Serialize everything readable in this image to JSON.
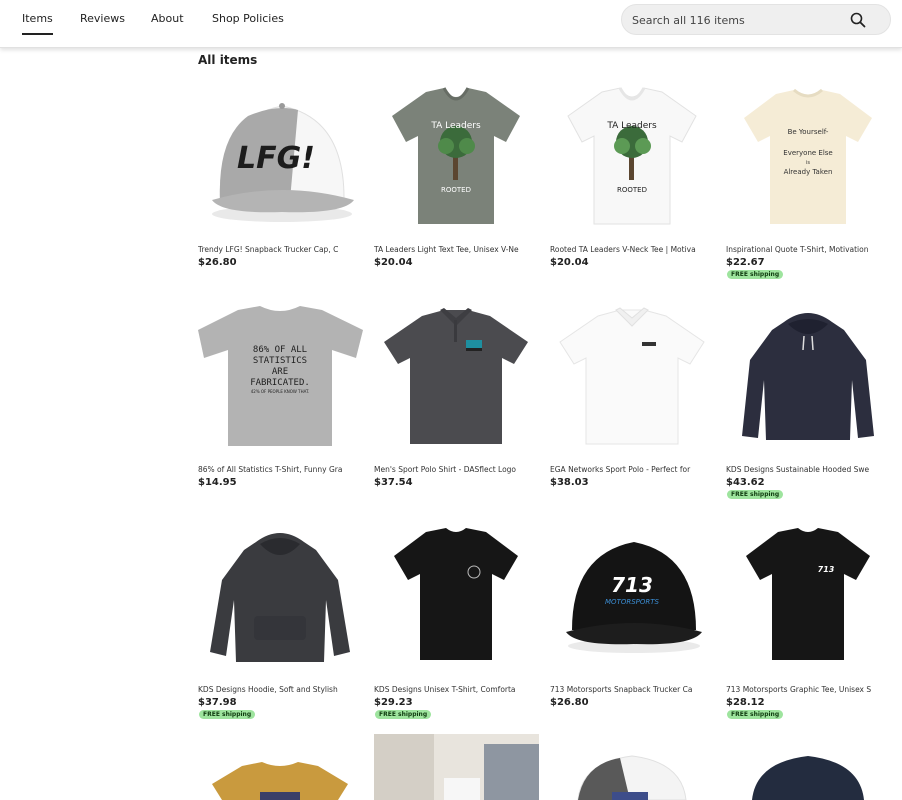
{
  "nav": {
    "tabs": [
      "Items",
      "Reviews",
      "About",
      "Shop Policies"
    ],
    "active_tab": "Items",
    "search_placeholder": "Search all 116 items",
    "search_icon": "search-icon"
  },
  "section_title": "All items",
  "items": [
    {
      "title": "Trendy LFG! Snapback Trucker Cap, C",
      "price": "$26.80",
      "free_shipping": ""
    },
    {
      "title": "TA Leaders Light Text Tee, Unisex V-Ne",
      "price": "$20.04",
      "free_shipping": ""
    },
    {
      "title": "Rooted TA Leaders V-Neck Tee | Motiva",
      "price": "$20.04",
      "free_shipping": ""
    },
    {
      "title": "Inspirational Quote T-Shirt, Motivation",
      "price": "$22.67",
      "free_shipping": "FREE shipping"
    },
    {
      "title": "86% of All Statistics T-Shirt, Funny Gra",
      "price": "$14.95",
      "free_shipping": ""
    },
    {
      "title": "Men's Sport Polo Shirt - DASflect Logo",
      "price": "$37.54",
      "free_shipping": ""
    },
    {
      "title": "EGA Networks Sport Polo - Perfect for",
      "price": "$38.03",
      "free_shipping": ""
    },
    {
      "title": "KDS Designs Sustainable Hooded Swe",
      "price": "$43.62",
      "free_shipping": "FREE shipping"
    },
    {
      "title": "KDS Designs Hoodie, Soft and Stylish",
      "price": "$37.98",
      "free_shipping": "FREE shipping"
    },
    {
      "title": "KDS Designs Unisex T-Shirt, Comforta",
      "price": "$29.23",
      "free_shipping": "FREE shipping"
    },
    {
      "title": "713 Motorsports Snapback Trucker Ca",
      "price": "$26.80",
      "free_shipping": ""
    },
    {
      "title": "713 Motorsports Graphic Tee, Unisex S",
      "price": "$28.12",
      "free_shipping": "FREE shipping"
    }
  ],
  "image_text": {
    "lfg": "LFG!",
    "ta_leaders": "TA Leaders",
    "rooted": "ROOTED",
    "quote": [
      "Be Yourself-",
      "Everyone Else",
      "is",
      "Already Taken"
    ],
    "stats": [
      "86% OF ALL",
      "STATISTICS",
      "ARE",
      "FABRICATED.",
      "42% OF PEOPLE KNOW THAT."
    ],
    "m713": "713",
    "motorsports": "MOTORSPORTS"
  },
  "colors": {
    "accent": "#222222",
    "badge_bg": "#9ee49e",
    "badge_text": "#0f3b0f",
    "search_bg": "#efefef"
  }
}
